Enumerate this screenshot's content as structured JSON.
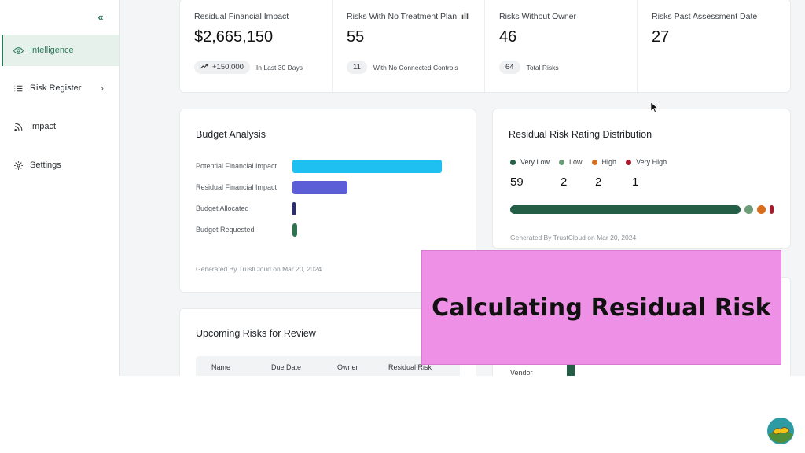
{
  "sidebar": {
    "collapse_icon": "double-chevron-left-icon",
    "items": [
      {
        "label": "Intelligence",
        "icon": "eye-icon"
      },
      {
        "label": "Risk Register",
        "icon": "list-icon"
      },
      {
        "label": "Impact",
        "icon": "rss-icon"
      },
      {
        "label": "Settings",
        "icon": "gear-icon"
      }
    ]
  },
  "stats": [
    {
      "label": "Residual Financial Impact",
      "value": "$2,665,150",
      "pill": "+150,000",
      "note": "In Last 30 Days"
    },
    {
      "label": "Risks With No Treatment Plan",
      "value": "55",
      "pill": "11",
      "note": "With No Connected Controls"
    },
    {
      "label": "Risks Without Owner",
      "value": "46",
      "pill": "64",
      "note": "Total Risks"
    },
    {
      "label": "Risks Past Assessment Date",
      "value": "27"
    }
  ],
  "budget": {
    "title": "Budget Analysis",
    "generated": "Generated By TrustCloud on Mar 20, 2024",
    "bars": [
      {
        "label": "Potential Financial Impact",
        "fraction": 1.0,
        "color": "#1ec0f2"
      },
      {
        "label": "Residual Financial Impact",
        "fraction": 0.37,
        "color": "#5b5ed6"
      },
      {
        "label": "Budget Allocated",
        "fraction": 0.015,
        "color": "#2d2e6e"
      },
      {
        "label": "Budget Requested",
        "fraction": 0.03,
        "color": "#2f7350"
      }
    ]
  },
  "distribution": {
    "title": "Residual Risk Rating Distribution",
    "generated": "Generated By TrustCloud on Mar 20, 2024",
    "categories": [
      {
        "label": "Very Low",
        "count": "59",
        "color": "#245e47"
      },
      {
        "label": "Low",
        "count": "2",
        "color": "#6c9c77"
      },
      {
        "label": "High",
        "count": "2",
        "color": "#d96d1e"
      },
      {
        "label": "Very High",
        "count": "1",
        "color": "#a51b2b"
      }
    ]
  },
  "upcoming": {
    "title": "Upcoming Risks for Review",
    "columns": [
      "Name",
      "Due Date",
      "Owner",
      "Residual Risk"
    ]
  },
  "partial_card": {
    "label": "Vendor"
  },
  "overlay": {
    "text": "Calculating Residual Risk"
  }
}
